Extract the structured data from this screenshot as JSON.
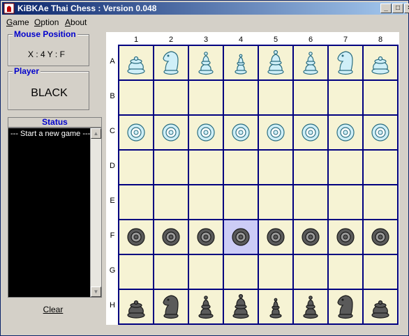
{
  "window": {
    "title": "KiBKAe Thai Chess : Version 0.048"
  },
  "menu": [
    {
      "label_ul": "G",
      "label_rest": "ame"
    },
    {
      "label_ul": "O",
      "label_rest": "ption"
    },
    {
      "label_ul": "A",
      "label_rest": "bout"
    }
  ],
  "mouse_position": {
    "title": "Mouse Position",
    "value": "X : 4  Y : F"
  },
  "player": {
    "title": "Player",
    "value": "BLACK"
  },
  "status": {
    "title": "Status",
    "log": "--- Start a new game ---"
  },
  "clear_label": "Clear",
  "board": {
    "columns": [
      "1",
      "2",
      "3",
      "4",
      "5",
      "6",
      "7",
      "8"
    ],
    "rows": [
      "A",
      "B",
      "C",
      "D",
      "E",
      "F",
      "G",
      "H"
    ],
    "selected": "F4",
    "pieces": [
      {
        "square": "A1",
        "color": "white",
        "type": "king"
      },
      {
        "square": "A2",
        "color": "white",
        "type": "horse"
      },
      {
        "square": "A3",
        "color": "white",
        "type": "boat"
      },
      {
        "square": "A4",
        "color": "white",
        "type": "queen"
      },
      {
        "square": "A5",
        "color": "white",
        "type": "elephant"
      },
      {
        "square": "A6",
        "color": "white",
        "type": "boat"
      },
      {
        "square": "A7",
        "color": "white",
        "type": "horse"
      },
      {
        "square": "A8",
        "color": "white",
        "type": "king"
      },
      {
        "square": "C1",
        "color": "white",
        "type": "pawn"
      },
      {
        "square": "C2",
        "color": "white",
        "type": "pawn"
      },
      {
        "square": "C3",
        "color": "white",
        "type": "pawn"
      },
      {
        "square": "C4",
        "color": "white",
        "type": "pawn"
      },
      {
        "square": "C5",
        "color": "white",
        "type": "pawn"
      },
      {
        "square": "C6",
        "color": "white",
        "type": "pawn"
      },
      {
        "square": "C7",
        "color": "white",
        "type": "pawn"
      },
      {
        "square": "C8",
        "color": "white",
        "type": "pawn"
      },
      {
        "square": "F1",
        "color": "black",
        "type": "pawn"
      },
      {
        "square": "F2",
        "color": "black",
        "type": "pawn"
      },
      {
        "square": "F3",
        "color": "black",
        "type": "pawn"
      },
      {
        "square": "F4",
        "color": "black",
        "type": "pawn"
      },
      {
        "square": "F5",
        "color": "black",
        "type": "pawn"
      },
      {
        "square": "F6",
        "color": "black",
        "type": "pawn"
      },
      {
        "square": "F7",
        "color": "black",
        "type": "pawn"
      },
      {
        "square": "F8",
        "color": "black",
        "type": "pawn"
      },
      {
        "square": "H1",
        "color": "black",
        "type": "king"
      },
      {
        "square": "H2",
        "color": "black",
        "type": "horse"
      },
      {
        "square": "H3",
        "color": "black",
        "type": "boat"
      },
      {
        "square": "H4",
        "color": "black",
        "type": "elephant"
      },
      {
        "square": "H5",
        "color": "black",
        "type": "queen"
      },
      {
        "square": "H6",
        "color": "black",
        "type": "boat"
      },
      {
        "square": "H7",
        "color": "black",
        "type": "horse"
      },
      {
        "square": "H8",
        "color": "black",
        "type": "king"
      }
    ]
  },
  "colors": {
    "white_piece": "#cfeff8",
    "black_piece": "#5a5a5a",
    "board_light": "#f6f3d4",
    "selected": "#ccccf6",
    "grid": "#000080"
  }
}
